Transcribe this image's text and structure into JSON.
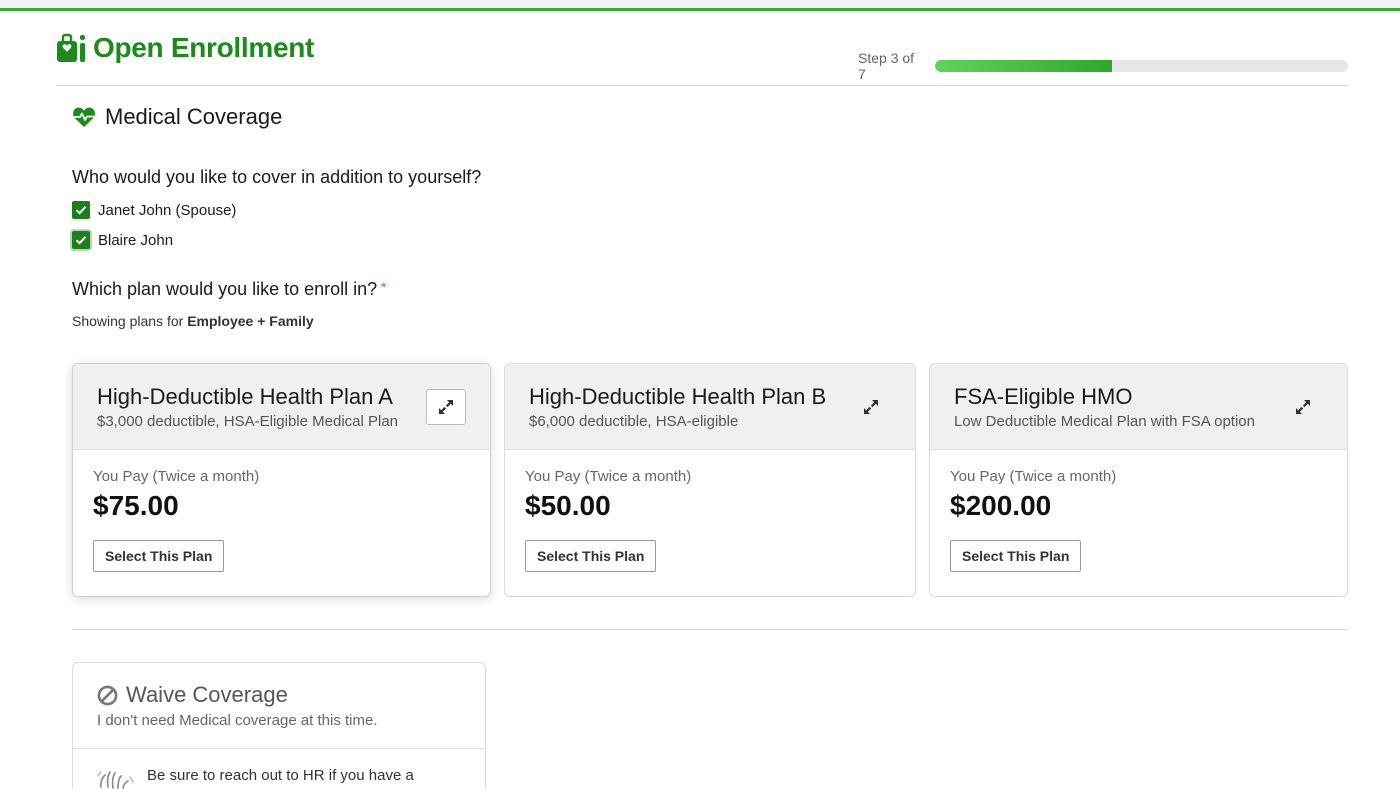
{
  "app": {
    "title": "Open Enrollment",
    "step_label": "Step 3 of 7",
    "progress_fraction": 0.43
  },
  "section": {
    "title": "Medical Coverage"
  },
  "dependents": {
    "question": "Who would you like to cover in addition to yourself?",
    "items": [
      {
        "label": "Janet John (Spouse)",
        "checked": true
      },
      {
        "label": "Blaire John",
        "checked": true
      }
    ]
  },
  "plans_section": {
    "question": "Which plan would you like to enroll in?",
    "required_marker": "*",
    "showing_prefix": "Showing plans for",
    "showing_tier": "Employee + Family"
  },
  "plans": [
    {
      "name": "High-Deductible Health Plan A",
      "subtitle": "$3,000 deductible, HSA-Eligible Medical Plan",
      "pay_label": "You Pay (Twice a month)",
      "amount": "$75.00",
      "button": "Select This Plan"
    },
    {
      "name": "High-Deductible Health Plan B",
      "subtitle": "$6,000 deductible, HSA-eligible",
      "pay_label": "You Pay (Twice a month)",
      "amount": "$50.00",
      "button": "Select This Plan"
    },
    {
      "name": "FSA-Eligible HMO",
      "subtitle": "Low Deductible Medical Plan with FSA option",
      "pay_label": "You Pay (Twice a month)",
      "amount": "$200.00",
      "button": "Select This Plan"
    }
  ],
  "waive": {
    "title": "Waive Coverage",
    "subtitle": "I don't need Medical coverage at this time.",
    "note": "Be sure to reach out to HR if you have a"
  },
  "colors": {
    "brand_green": "#1e8a1c",
    "check_green": "#1e7d1c",
    "progress_green": "#2ea82a"
  }
}
